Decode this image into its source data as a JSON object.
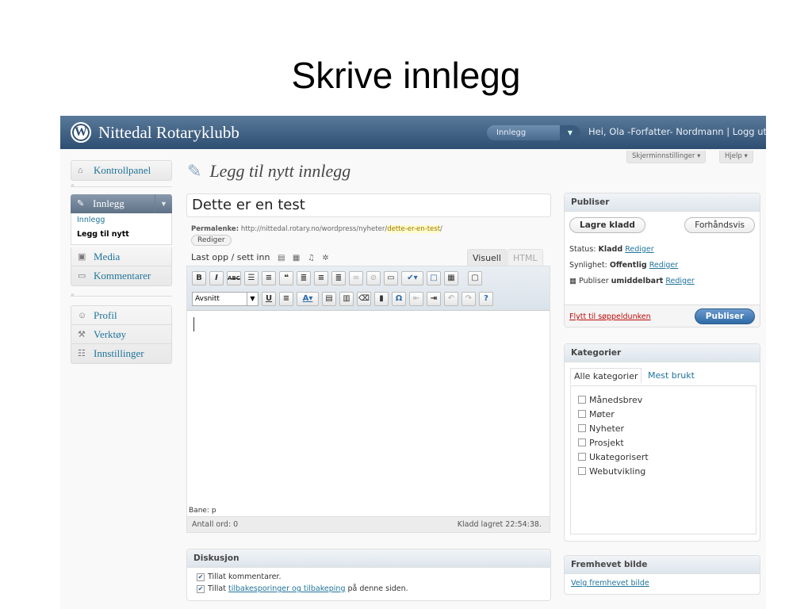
{
  "slide_title": "Skrive innlegg",
  "header": {
    "site_title": "Nittedal Rotaryklubb",
    "favorites_selected": "Innlegg",
    "howdy": "Hei, Ola -Forfatter- Nordmann | Logg ut"
  },
  "screen_options": {
    "screen_label": "Skjerminnstillinger ▾",
    "help_label": "Hjelp ▾"
  },
  "sidebar": {
    "dashboard": "Kontrollpanel",
    "posts": "Innlegg",
    "posts_sub": [
      "Innlegg",
      "Legg til nytt"
    ],
    "media": "Media",
    "comments": "Kommentarer",
    "profile": "Profil",
    "tools": "Verktøy",
    "settings": "Innstillinger"
  },
  "main": {
    "heading": "Legg til nytt innlegg",
    "post_title": "Dette er en test",
    "permalink_label": "Permalenke:",
    "permalink_base": "http://nittedal.rotary.no/wordpress/nyheter/",
    "permalink_slug": "dette-er-en-test",
    "permalink_end": "/",
    "edit_permalink": "Rediger",
    "upload_label": "Last opp / sett inn",
    "tab_visual": "Visuell",
    "tab_html": "HTML",
    "format_select": "Avsnitt",
    "path": "Bane: p",
    "word_count": "Antall ord: 0",
    "draft_saved": "Kladd lagret 22:54:38."
  },
  "discussion": {
    "title": "Diskusjon",
    "allow_comments": "Tillat kommentarer.",
    "allow_pre": "Tillat",
    "allow_link": "tilbakesporinger og tilbakeping",
    "allow_post": "på denne siden."
  },
  "publish": {
    "title": "Publiser",
    "save_draft": "Lagre kladd",
    "preview": "Forhåndsvis",
    "status_label": "Status:",
    "status_value": "Kladd",
    "visibility_label": "Synlighet:",
    "visibility_value": "Offentlig",
    "publish_label": "Publiser",
    "publish_value": "umiddelbart",
    "edit": "Rediger",
    "trash": "Flytt til søppeldunken",
    "publish_button": "Publiser"
  },
  "categories": {
    "title": "Kategorier",
    "tab_all": "Alle kategorier",
    "tab_popular": "Mest brukt",
    "items": [
      "Månedsbrev",
      "Møter",
      "Nyheter",
      "Prosjekt",
      "Ukategorisert",
      "Webutvikling"
    ]
  },
  "featured": {
    "title": "Fremhevet bilde",
    "link": "Velg fremhevet bilde"
  }
}
